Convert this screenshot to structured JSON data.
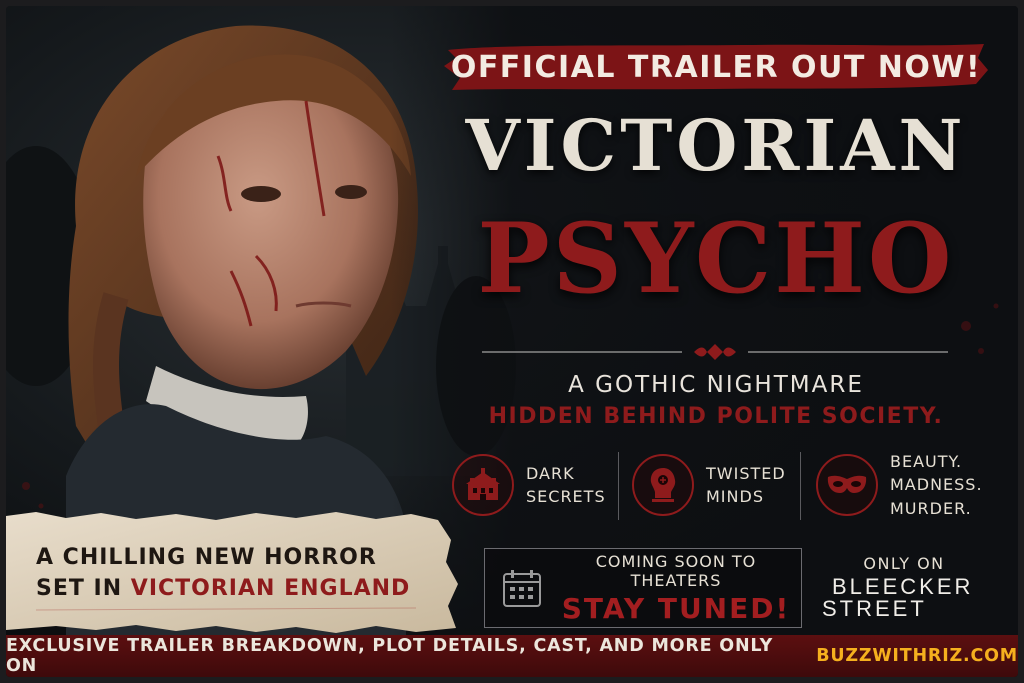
{
  "banner": {
    "text": "OFFICIAL TRAILER OUT NOW!"
  },
  "title": {
    "line1": "VICTORIAN",
    "line2": "PSYCHO"
  },
  "tagline": {
    "line1": "A GOTHIC NIGHTMARE",
    "line2": "HIDDEN BEHIND POLITE SOCIETY."
  },
  "features": [
    {
      "icon": "mansion-icon",
      "label": "DARK\nSECRETS"
    },
    {
      "icon": "head-silhouette-icon",
      "label": "TWISTED\nMINDS"
    },
    {
      "icon": "mask-icon",
      "label": "BEAUTY.\nMADNESS.\nMURDER."
    }
  ],
  "release": {
    "icon": "calendar-icon",
    "line1": "COMING SOON TO THEATERS",
    "line2": "STAY TUNED!"
  },
  "distributor": {
    "prefix": "ONLY ON",
    "brand_line1": "BLEECKER",
    "brand_line2": "STREET"
  },
  "paper_note": {
    "line1": "A CHILLING NEW HORROR",
    "line2_prefix": "SET IN ",
    "line2_highlight": "VICTORIAN ENGLAND"
  },
  "footer": {
    "text": "EXCLUSIVE TRAILER BREAKDOWN, PLOT DETAILS, CAST, AND MORE ONLY ON",
    "highlight": "BUZZWITHRIZ.COM"
  },
  "colors": {
    "accent_red": "#8e1b1c",
    "footer_bg": "#4d0c0d",
    "highlight_yellow": "#f5b01e",
    "background": "#0d0f12"
  }
}
